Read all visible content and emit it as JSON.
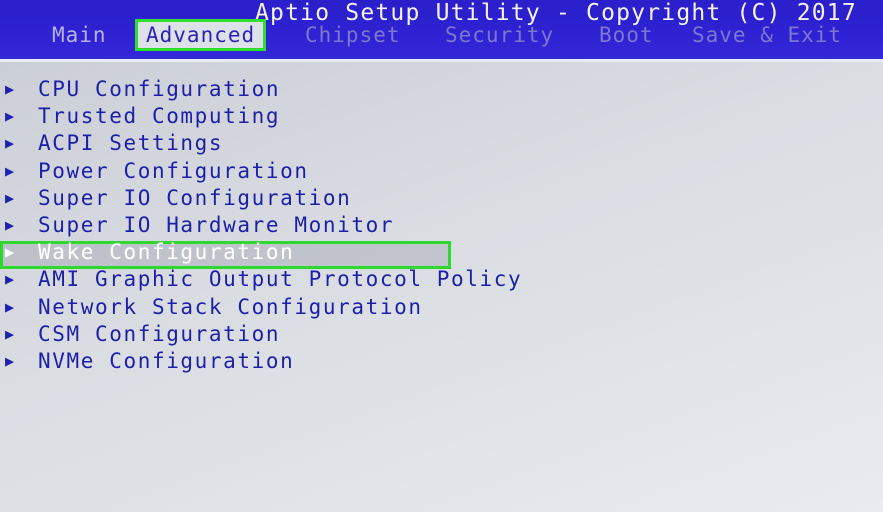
{
  "header": {
    "title": "Aptio Setup Utility - Copyright (C) 2017",
    "tabs": [
      {
        "label": "Main"
      },
      {
        "label": "Advanced"
      },
      {
        "label": "Chipset"
      },
      {
        "label": "Security"
      },
      {
        "label": "Boot"
      },
      {
        "label": "Save & Exit"
      }
    ],
    "active_tab": "Advanced"
  },
  "menu": {
    "items": [
      {
        "label": "CPU Configuration"
      },
      {
        "label": "Trusted Computing"
      },
      {
        "label": "ACPI Settings"
      },
      {
        "label": "Power Configuration"
      },
      {
        "label": "Super IO Configuration"
      },
      {
        "label": "Super IO Hardware Monitor"
      },
      {
        "label": "Wake Configuration"
      },
      {
        "label": "AMI Graphic Output Protocol Policy"
      },
      {
        "label": "Network Stack Configuration"
      },
      {
        "label": "CSM Configuration"
      },
      {
        "label": "NVMe Configuration"
      }
    ],
    "selected_item": "Wake Configuration"
  },
  "colors": {
    "header_bg": "#2e22d3",
    "menu_text": "#1c1fa8",
    "highlight_box": "#2fd82f",
    "body_bg": "#d9dde2"
  },
  "icons": {
    "submenu_arrow": "triangle-right-icon"
  }
}
